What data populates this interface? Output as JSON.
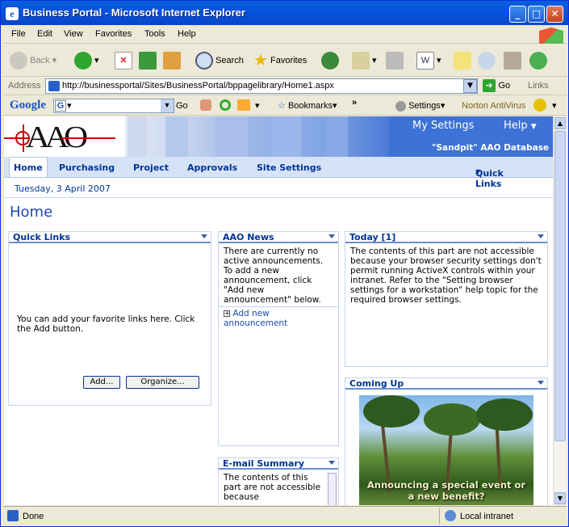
{
  "window": {
    "title": "Business Portal - Microsoft Internet Explorer",
    "icon_letter": "e"
  },
  "menu": [
    "File",
    "Edit",
    "View",
    "Favorites",
    "Tools",
    "Help"
  ],
  "toolbar": {
    "back": "Back",
    "search": "Search",
    "favorites": "Favorites"
  },
  "address": {
    "label": "Address",
    "url": "http://businessportal/Sites/BusinessPortal/bppagelibrary/Home1.aspx",
    "go": "Go",
    "links": "Links"
  },
  "googlebar": {
    "brand": "Google",
    "go": "Go",
    "bookmarks": "Bookmarks",
    "settings": "Settings",
    "norton": "Norton AntiVirus",
    "g_letter": "G"
  },
  "portal": {
    "logo": "AAO",
    "my_settings": "My Settings",
    "help": "Help",
    "database": "\"Sandpit\" AAO Database",
    "nav": [
      "Home",
      "Purchasing",
      "Project",
      "Approvals",
      "Site Settings"
    ],
    "quick_links_nav": "Quick Links",
    "date": "Tuesday, 3 April 2007",
    "page_title": "Home"
  },
  "parts": {
    "quick_links": {
      "title": "Quick Links",
      "text": "You can add your favorite links here. Click the Add button.",
      "add": "Add...",
      "organize": "Organize..."
    },
    "news": {
      "title": "AAO News",
      "text": "There are currently no active announcements. To add a new announcement, click \"Add new announcement\" below.",
      "link": "Add new announcement"
    },
    "today": {
      "title": "Today [1]",
      "text": "The contents of this part are not accessible because your browser security settings don't permit running ActiveX controls within your intranet. Refer to the \"Setting browser settings for a workstation\" help topic for the required browser settings."
    },
    "email": {
      "title": "E-mail Summary",
      "text": "The contents of this part are not accessible because"
    },
    "coming_up": {
      "title": "Coming Up",
      "caption": "Announcing a special event or a new benefit?"
    }
  },
  "status": {
    "left": "Done",
    "zone": "Local intranet"
  },
  "colors": {
    "portal_blue": "#003399",
    "banner_blue": "#4b7bd8",
    "xp_title": "#0a5fd8"
  }
}
